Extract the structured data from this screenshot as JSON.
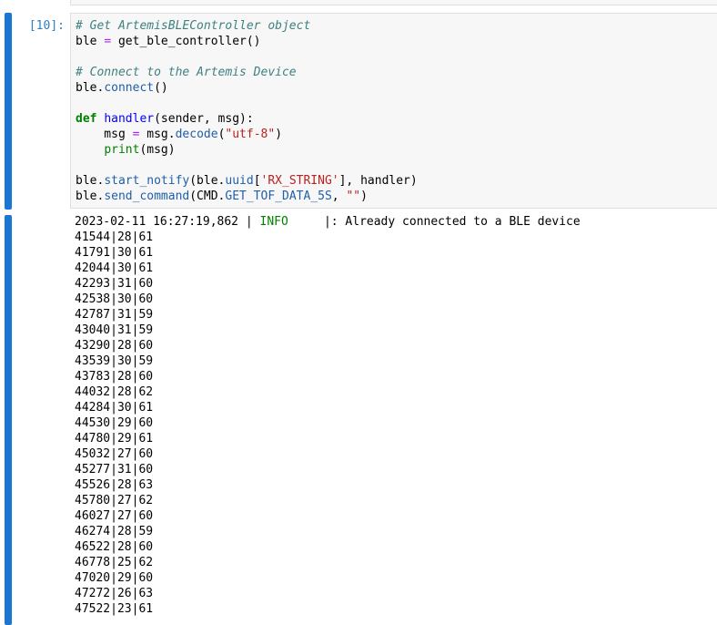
{
  "cell": {
    "prompt": "[10]:",
    "code_lines": [
      [
        [
          "c",
          "# Get ArtemisBLEController object"
        ]
      ],
      [
        [
          "",
          "ble "
        ],
        [
          "o",
          "="
        ],
        [
          "",
          " get_ble_controller()"
        ]
      ],
      [],
      [
        [
          "c",
          "# Connect to the Artemis Device"
        ]
      ],
      [
        [
          "",
          "ble."
        ],
        [
          "a",
          "connect"
        ],
        [
          "",
          "()"
        ]
      ],
      [],
      [
        [
          "k",
          "def"
        ],
        [
          "",
          " "
        ],
        [
          "f",
          "handler"
        ],
        [
          "",
          "(sender, msg):"
        ]
      ],
      [
        [
          "",
          "    msg "
        ],
        [
          "o",
          "="
        ],
        [
          "",
          " msg."
        ],
        [
          "a",
          "decode"
        ],
        [
          "",
          "("
        ],
        [
          "s",
          "\"utf-8\""
        ],
        [
          "",
          ")"
        ]
      ],
      [
        [
          "",
          "    "
        ],
        [
          "b",
          "print"
        ],
        [
          "",
          "(msg)"
        ]
      ],
      [],
      [
        [
          "",
          "ble."
        ],
        [
          "a",
          "start_notify"
        ],
        [
          "",
          "(ble."
        ],
        [
          "a",
          "uuid"
        ],
        [
          "",
          "["
        ],
        [
          "s",
          "'RX_STRING'"
        ],
        [
          "",
          "], handler)"
        ]
      ],
      [
        [
          "",
          "ble."
        ],
        [
          "a",
          "send_command"
        ],
        [
          "",
          "(CMD."
        ],
        [
          "a",
          "GET_TOF_DATA_5S"
        ],
        [
          "",
          ", "
        ],
        [
          "s",
          "\"\""
        ],
        [
          "",
          ")"
        ]
      ]
    ]
  },
  "output": {
    "log": {
      "timestamp": "2023-02-11 16:27:19,862 | ",
      "level": "INFO",
      "message": "     |: Already connected to a BLE device"
    },
    "lines": [
      "41544|28|61",
      "41791|30|61",
      "42044|30|61",
      "42293|31|60",
      "42538|30|60",
      "42787|31|59",
      "43040|31|59",
      "43290|28|60",
      "43539|30|59",
      "43783|28|60",
      "44032|28|62",
      "44284|30|61",
      "44530|29|60",
      "44780|29|61",
      "45032|27|60",
      "45277|31|60",
      "45526|28|63",
      "45780|27|62",
      "46027|27|60",
      "46274|28|59",
      "46522|28|60",
      "46778|25|62",
      "47020|29|60",
      "47272|26|63",
      "47522|23|61"
    ]
  },
  "colors": {
    "accent": "#1976d2"
  }
}
